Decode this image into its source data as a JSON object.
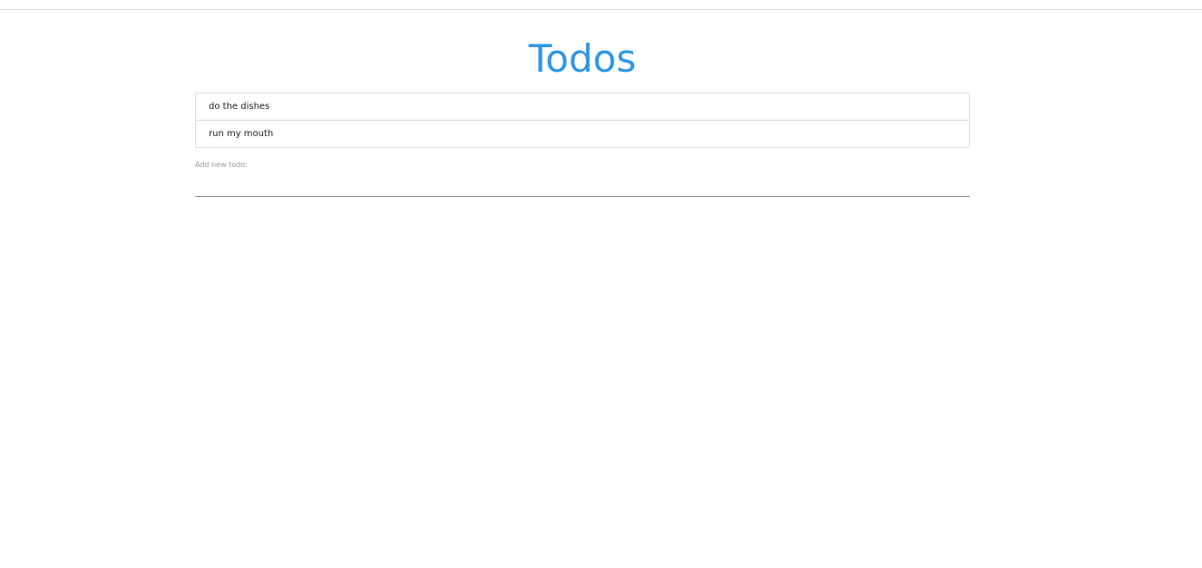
{
  "header": {
    "title": "Todos"
  },
  "todos": [
    {
      "text": "do the dishes"
    },
    {
      "text": "run my mouth"
    }
  ],
  "new_todo": {
    "label": "Add new todo:",
    "value": "",
    "placeholder": ""
  },
  "colors": {
    "title": "#2f96e6",
    "border": "#dcdcdc",
    "input_underline": "#8a8a8a",
    "label": "#9a9a9a"
  }
}
